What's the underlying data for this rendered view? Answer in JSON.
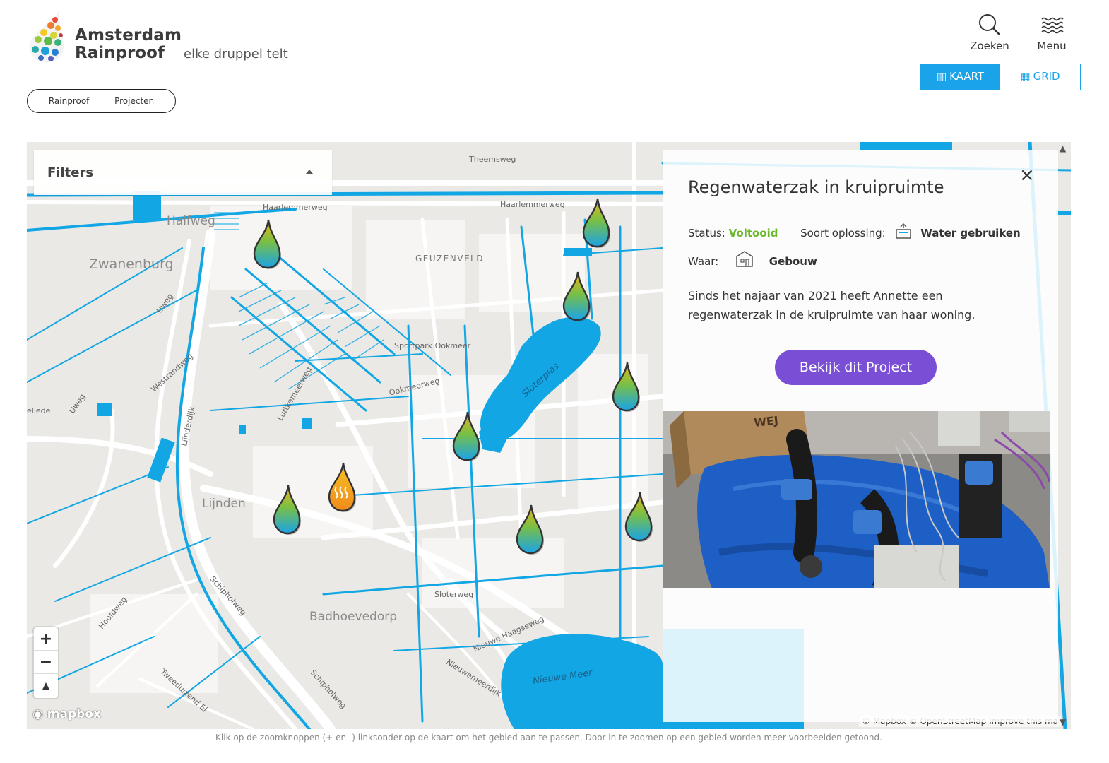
{
  "brand": {
    "name_line1": "Amsterdam",
    "name_line2": "Rainproof",
    "tagline": "elke druppel telt"
  },
  "header": {
    "search_label": "Zoeken",
    "menu_label": "Menu"
  },
  "view_toggle": {
    "kaart_label": "KAART",
    "grid_label": "GRID",
    "active": "kaart"
  },
  "breadcrumb": {
    "items": [
      "Rainproof",
      "Projecten"
    ]
  },
  "filters": {
    "label": "Filters"
  },
  "map_labels": {
    "halfweg": "Halfweg",
    "zwanenburg": "Zwanenburg",
    "geuzenveld": "GEUZENVELD",
    "lijnden": "Lijnden",
    "badhoevedorp": "Badhoevedorp",
    "haarlemmerweg1": "Haarlemmerweg",
    "haarlemmerweg2": "Haarlemmerweg",
    "theemsweg": "Theemsweg",
    "sportpark": "Sportpark Ookmeer",
    "ookmeerweg": "Ookmeerweg",
    "sloterplas": "Sloterplas",
    "sloterweg": "Sloterweg",
    "nieuwe_haagseweg": "Nieuwe Haagseweg",
    "nieuwe_meer": "Nieuwe Meer",
    "nieuwemeerdijk": "Nieuwemeerdijk",
    "schipholweg1": "Schipholweg",
    "schipholweg2": "Schipholweg",
    "hoofdweg": "Hoofdweg",
    "tweeduizend": "Tweeduizend El",
    "westrandweg": "Westrandweg",
    "luttkemeerweg": "Luttkemeerweg",
    "lijnderdijk": "Lijnderdijk",
    "uweg1": "Uweg",
    "uweg2": "Uweg",
    "aliede": "eliede"
  },
  "map_controls": {
    "zoom_in": "+",
    "zoom_out": "−",
    "compass": "▲",
    "mapbox": "mapbox",
    "attribution": "© Mapbox © OpenStreetMap  Improve this ma"
  },
  "popup": {
    "close": "×",
    "title": "Regenwaterzak in kruipruimte",
    "status_label": "Status:",
    "status_value": "Voltooid",
    "soort_label": "Soort oplossing:",
    "soort_value": "Water gebruiken",
    "waar_label": "Waar:",
    "waar_value": "Gebouw",
    "description": "Sinds het najaar van 2021 heeft Annette een regenwaterzak in de kruipruimte van haar woning.",
    "cta": "Bekijk dit Project"
  },
  "colors": {
    "accent_blue": "#1aa3e8",
    "cta_purple": "#7a4fd6",
    "status_green": "#6ab82a",
    "water": "#12a7e4"
  },
  "footnote": "Klik op de zoomknoppen (+ en -) linksonder op de kaart om het gebied aan te passen. Door in te zoomen op een gebied worden meer voorbeelden getoond."
}
